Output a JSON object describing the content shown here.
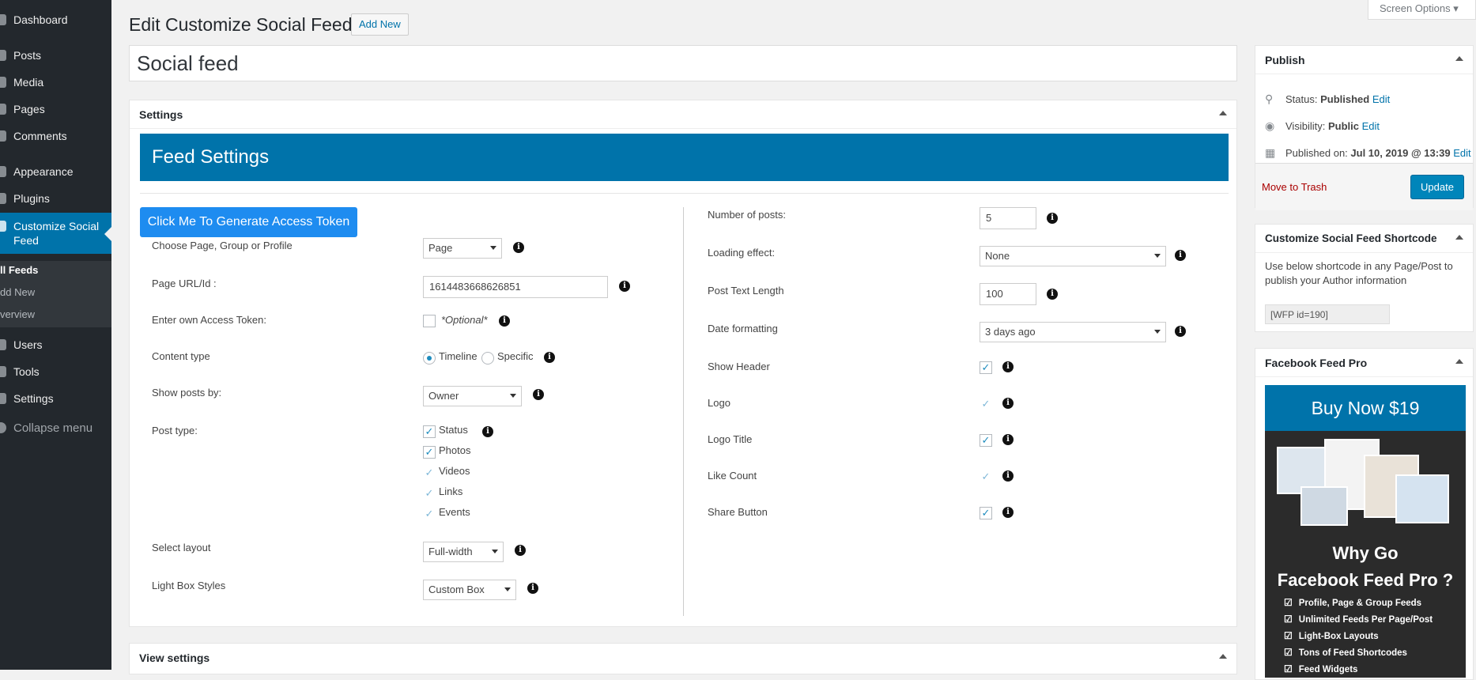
{
  "sidebar": {
    "items": [
      {
        "label": "Dashboard"
      },
      {
        "label": "Posts"
      },
      {
        "label": "Media"
      },
      {
        "label": "Pages"
      },
      {
        "label": "Comments"
      },
      {
        "label": "Appearance"
      },
      {
        "label": "Plugins"
      },
      {
        "label": "Customize Social Feed"
      },
      {
        "label": "Users"
      },
      {
        "label": "Tools"
      },
      {
        "label": "Settings"
      }
    ],
    "submenu": [
      {
        "label": "ll Feeds"
      },
      {
        "label": "dd New"
      },
      {
        "label": "verview"
      }
    ],
    "collapse_label": "Collapse menu"
  },
  "header": {
    "screen_options": "Screen Options ▾",
    "page_title": "Edit Customize Social Feed",
    "add_new": "Add New",
    "post_title": "Social feed"
  },
  "settings": {
    "box_title": "Settings",
    "banner": "Feed Settings",
    "token_button": "Click Me To Generate Access Token",
    "left": {
      "choose_label": "Choose Page, Group or Profile",
      "choose_value": "Page",
      "url_label": "Page URL/Id :",
      "url_value": "1614483668626851",
      "token_label": "Enter own Access Token:",
      "token_optional": "*Optional*",
      "content_label": "Content type",
      "content_options": [
        "Timeline",
        "Specific"
      ],
      "show_by_label": "Show posts by:",
      "show_by_value": "Owner",
      "post_type_label": "Post type:",
      "post_types": [
        {
          "label": "Status",
          "checked": true
        },
        {
          "label": "Photos",
          "checked": true
        },
        {
          "label": "Videos",
          "checked": true
        },
        {
          "label": "Links",
          "checked": true
        },
        {
          "label": "Events",
          "checked": true
        }
      ],
      "layout_label": "Select layout",
      "layout_value": "Full-width",
      "lightbox_label": "Light Box Styles",
      "lightbox_value": "Custom Box"
    },
    "right": {
      "num_posts_label": "Number of posts:",
      "num_posts_value": "5",
      "loading_label": "Loading effect:",
      "loading_value": "None",
      "text_length_label": "Post Text Length",
      "text_length_value": "100",
      "date_label": "Date formatting",
      "date_value": "3 days ago",
      "toggles": [
        {
          "label": "Show Header",
          "checked": true
        },
        {
          "label": "Logo",
          "checked": true
        },
        {
          "label": "Logo Title",
          "checked": true
        },
        {
          "label": "Like Count",
          "checked": true
        },
        {
          "label": "Share Button",
          "checked": true
        }
      ]
    }
  },
  "view_settings": {
    "title": "View settings"
  },
  "publish": {
    "title": "Publish",
    "status_label": "Status:",
    "status_value": "Published",
    "visibility_label": "Visibility:",
    "visibility_value": "Public",
    "published_label": "Published on:",
    "published_value": "Jul 10, 2019 @ 13:39",
    "edit": "Edit",
    "trash": "Move to Trash",
    "update": "Update"
  },
  "shortcode": {
    "title": "Customize Social Feed Shortcode",
    "description": "Use below shortcode in any Page/Post to publish your Author information",
    "code": "[WFP id=190]"
  },
  "pro": {
    "title": "Facebook Feed Pro",
    "buy": "Buy Now $19",
    "why_line1": "Why Go",
    "why_line2": "Facebook Feed Pro ?",
    "features": [
      "Profile, Page & Group Feeds",
      "Unlimited Feeds Per Page/Post",
      "Light-Box Layouts",
      "Tons of Feed Shortcodes",
      "Feed Widgets"
    ]
  },
  "colors": {
    "accent": "#0073aa",
    "sidebar": "#23282d",
    "token_button": "#1e8cf0"
  }
}
